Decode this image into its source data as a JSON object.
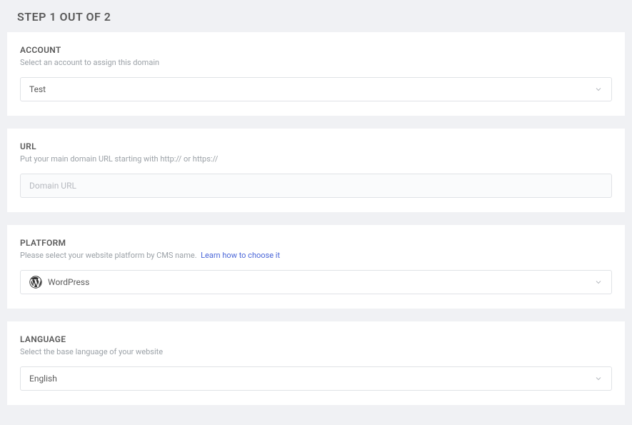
{
  "page": {
    "step_title": "STEP 1 OUT OF 2"
  },
  "account": {
    "label": "ACCOUNT",
    "help": "Select an account to assign this domain",
    "value": "Test"
  },
  "url": {
    "label": "URL",
    "help": "Put your main domain URL starting with http:// or https://",
    "placeholder": "Domain URL"
  },
  "platform": {
    "label": "PLATFORM",
    "help_prefix": "Please select your website platform by CMS name.",
    "help_link": "Learn how to choose it",
    "value": "WordPress"
  },
  "language": {
    "label": "LANGUAGE",
    "help": "Select the base language of your website",
    "value": "English"
  }
}
